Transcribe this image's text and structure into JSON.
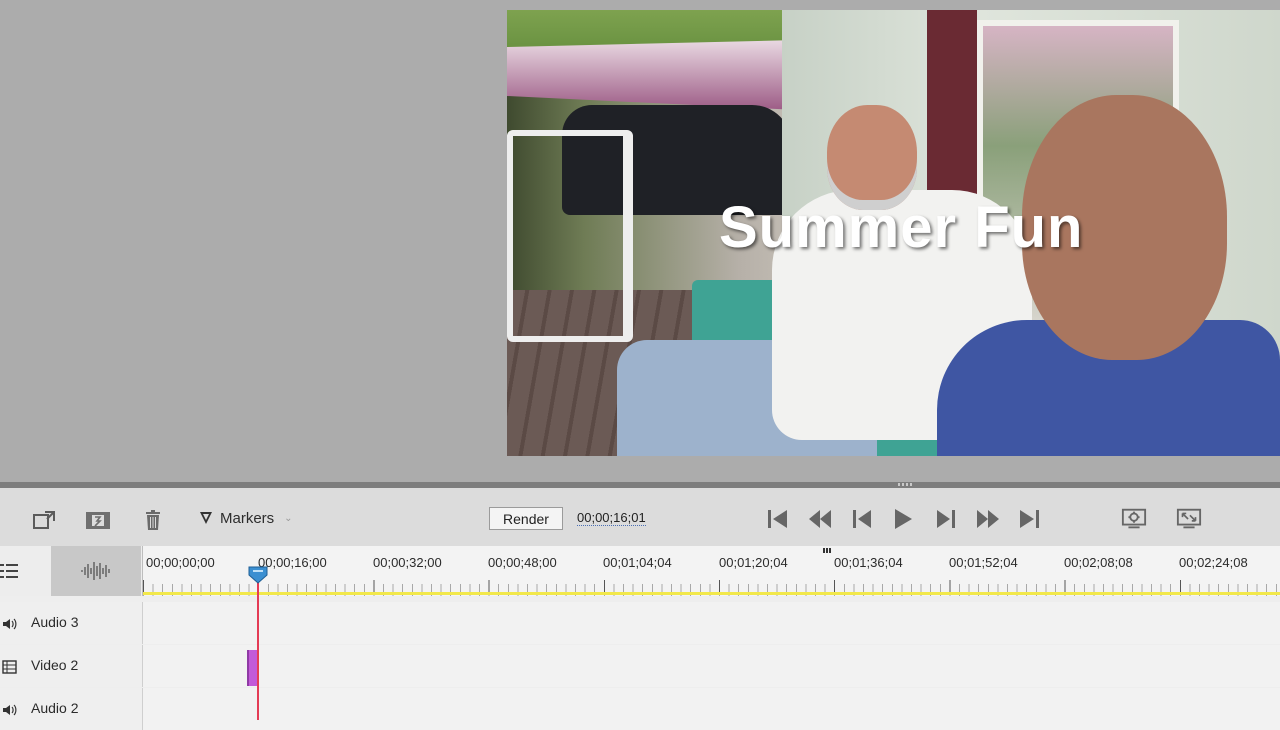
{
  "preview": {
    "title_overlay": "Summer Fun"
  },
  "toolbar": {
    "markers_label": "Markers",
    "render_label": "Render",
    "timecode": "00;00;16;01"
  },
  "ruler": {
    "labels": [
      "00;00;00;00",
      "00;00;16;00",
      "00;00;32;00",
      "00;00;48;00",
      "00;01;04;04",
      "00;01;20;04",
      "00;01;36;04",
      "00;01;52;04",
      "00;02;08;08",
      "00;02;24;08"
    ]
  },
  "tracks": [
    {
      "name": "Audio 3",
      "type": "audio"
    },
    {
      "name": "Video 2",
      "type": "video"
    },
    {
      "name": "Audio 2",
      "type": "audio"
    }
  ],
  "colors": {
    "playhead": "#e43b55",
    "clip": "#c25ad8",
    "work_area": "#f2e84a"
  }
}
